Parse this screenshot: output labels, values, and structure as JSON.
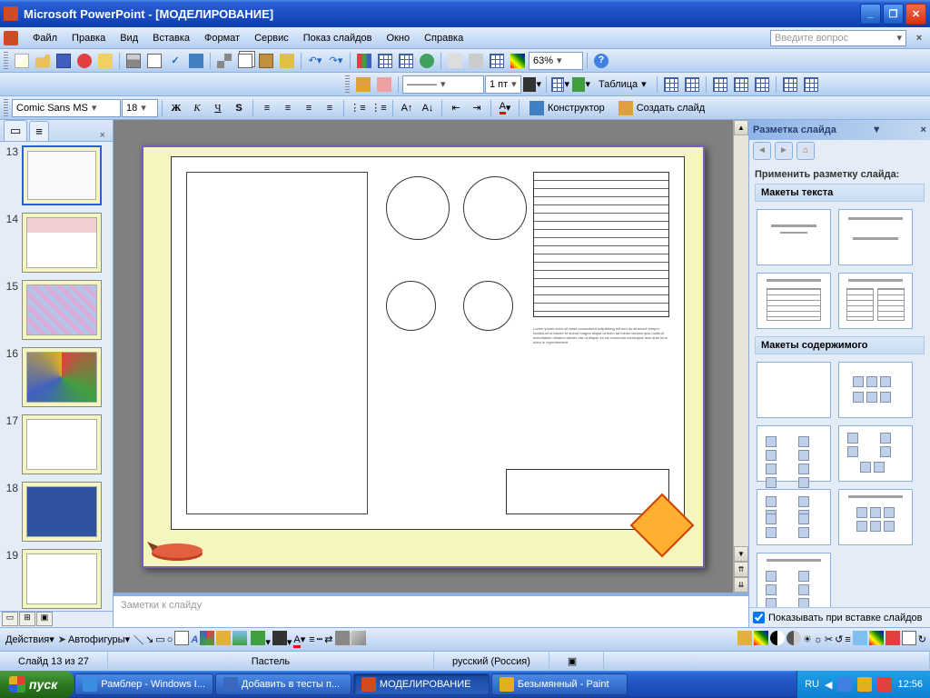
{
  "title": "Microsoft PowerPoint - [МОДЕЛИРОВАНИЕ]",
  "menu": [
    "Файл",
    "Правка",
    "Вид",
    "Вставка",
    "Формат",
    "Сервис",
    "Показ слайдов",
    "Окно",
    "Справка"
  ],
  "help_placeholder": "Введите вопрос",
  "zoom": "63%",
  "font_name": "Comic Sans MS",
  "font_size": "18",
  "line_weight": "1 пт",
  "table_label": "Таблица",
  "designer_label": "Конструктор",
  "new_slide_label": "Создать слайд",
  "slides": [
    {
      "n": "13"
    },
    {
      "n": "14"
    },
    {
      "n": "15"
    },
    {
      "n": "16"
    },
    {
      "n": "17"
    },
    {
      "n": "18"
    },
    {
      "n": "19"
    }
  ],
  "active_slide_index": 0,
  "notes_placeholder": "Заметки к слайду",
  "taskpane": {
    "title": "Разметка слайда",
    "apply_label": "Применить разметку слайда:",
    "section1": "Макеты текста",
    "section2": "Макеты содержимого",
    "show_checkbox": "Показывать при вставке слайдов"
  },
  "drawbar": {
    "actions": "Действия",
    "autoshapes": "Автофигуры"
  },
  "status": {
    "slide": "Слайд 13 из 27",
    "theme": "Пастель",
    "lang": "русский (Россия)"
  },
  "taskbar": {
    "start": "пуск",
    "items": [
      {
        "label": "Рамблер - Windows I...",
        "icon": "#3a8ee0"
      },
      {
        "label": "Добавить в тесты п...",
        "icon": "#3a68c0"
      },
      {
        "label": "МОДЕЛИРОВАНИЕ",
        "icon": "#d04a24",
        "active": true
      },
      {
        "label": "Безымянный - Paint",
        "icon": "#e0b020"
      }
    ],
    "lang": "RU",
    "time": "12:56"
  }
}
